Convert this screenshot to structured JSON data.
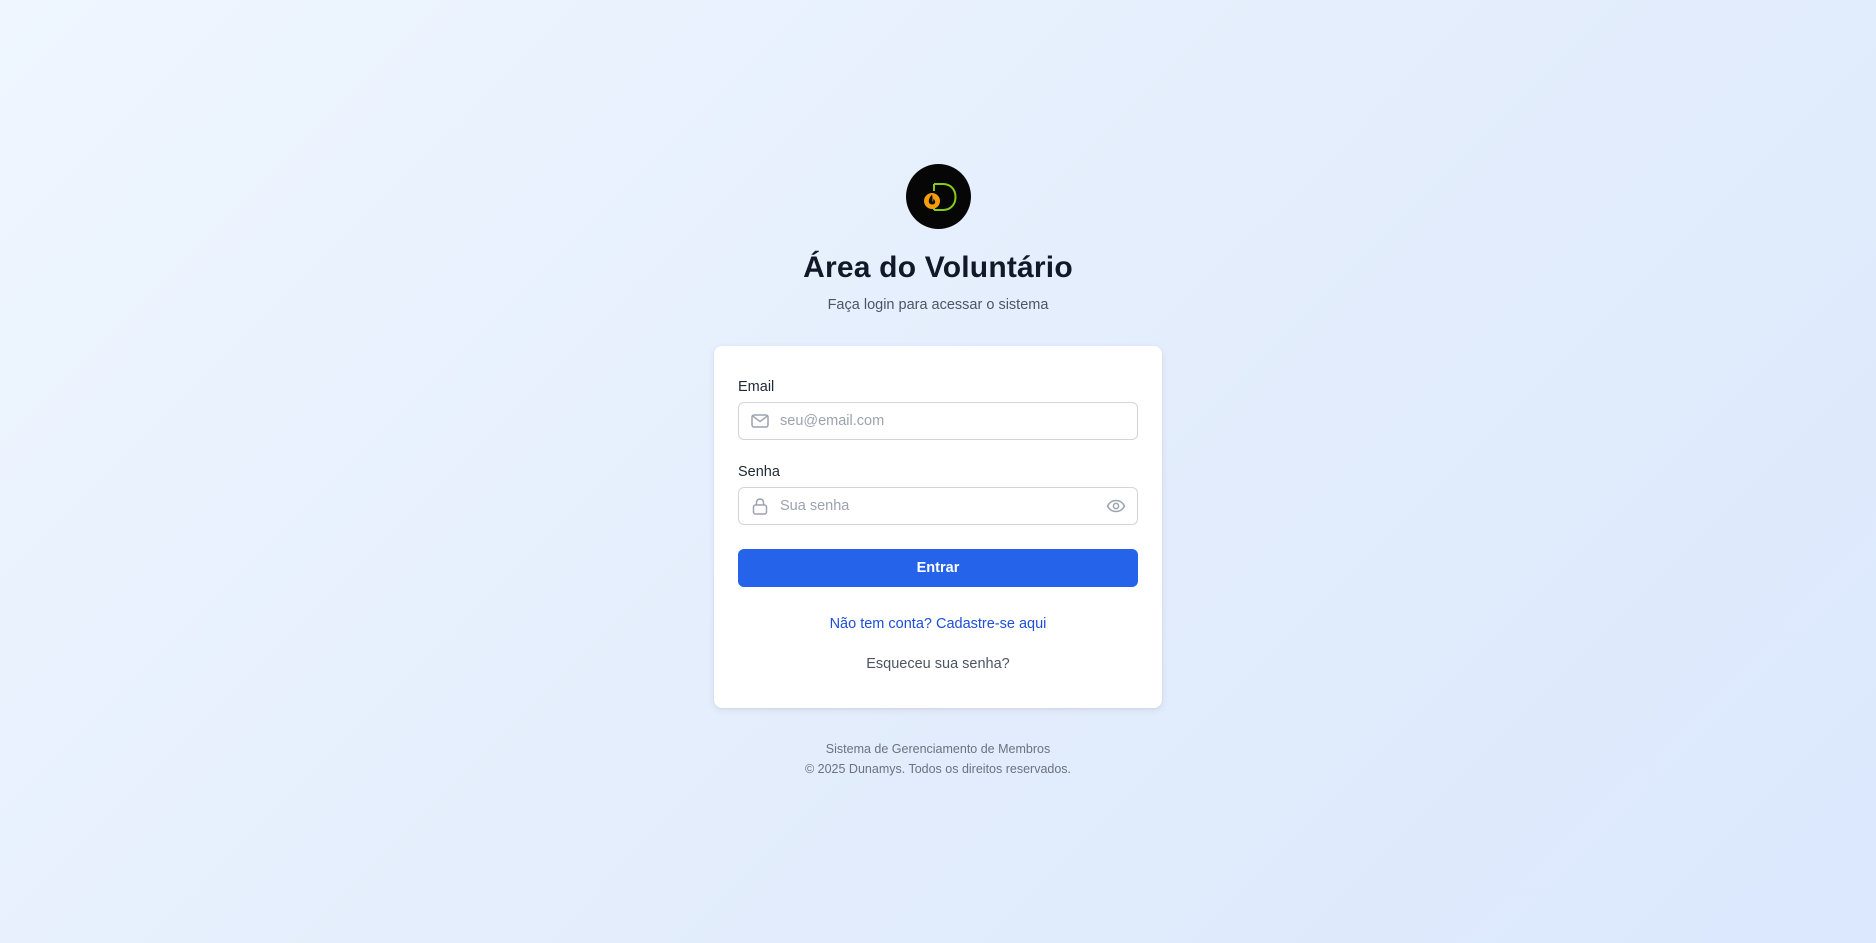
{
  "brand": {
    "logo_icon": "dunamys-flame-d-logo-icon",
    "logo_bg": "#060606",
    "logo_flame": "#f59e0b",
    "logo_letter": "#84cc16"
  },
  "header": {
    "title": "Área do Voluntário",
    "subtitle": "Faça login para acessar o sistema"
  },
  "form": {
    "email": {
      "label": "Email",
      "placeholder": "seu@email.com",
      "value": "",
      "icon": "mail-icon"
    },
    "password": {
      "label": "Senha",
      "placeholder": "Sua senha",
      "value": "",
      "icon": "lock-icon",
      "toggle_icon": "eye-icon"
    },
    "submit_label": "Entrar",
    "signup_link": "Não tem conta? Cadastre-se aqui",
    "forgot_link": "Esqueceu sua senha?"
  },
  "footer": {
    "line1": "Sistema de Gerenciamento de Membros",
    "line2": "© 2025 Dunamys. Todos os direitos reservados."
  },
  "colors": {
    "accent": "#2563eb",
    "link": "#1d4ed8",
    "background": "#e6effd"
  }
}
